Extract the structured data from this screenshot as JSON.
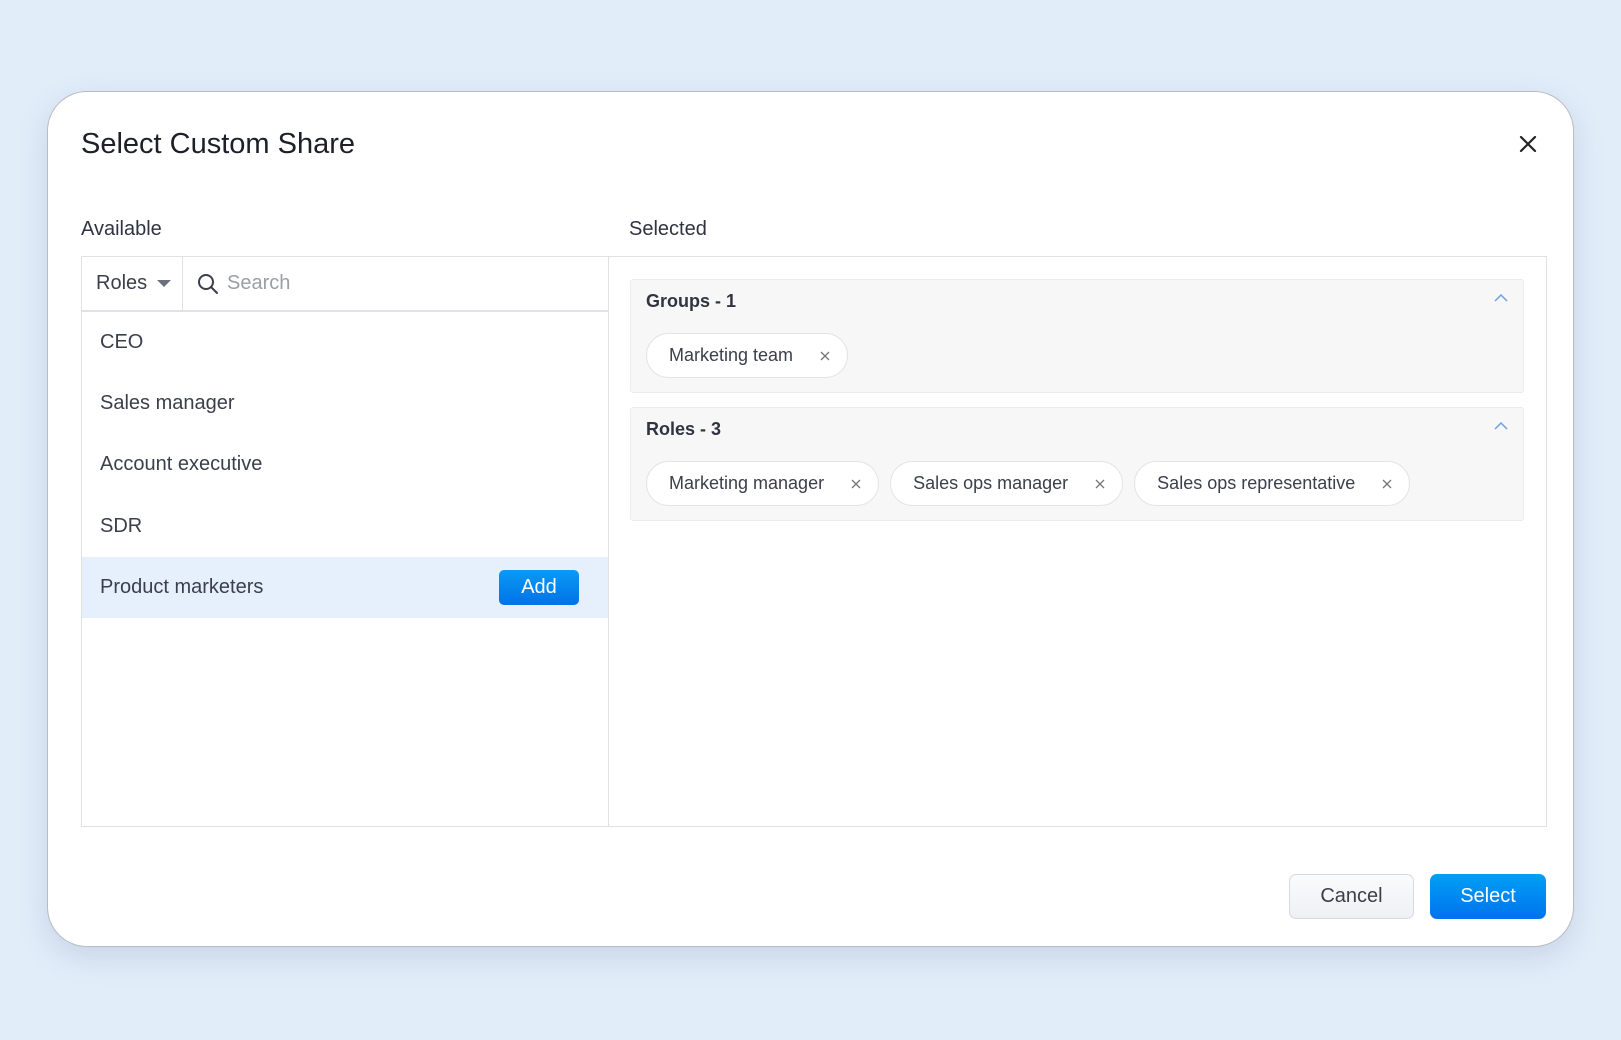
{
  "dialog": {
    "title": "Select Custom Share",
    "close_icon": "close-icon"
  },
  "available": {
    "label": "Available",
    "filter": "Roles",
    "search_placeholder": "Search",
    "items": [
      "CEO",
      "Sales manager",
      "Account executive",
      "SDR",
      "Product marketers"
    ],
    "add_label": "Add"
  },
  "selected": {
    "label": "Selected",
    "groups": [
      {
        "title": "Groups - 1",
        "chips": [
          "Marketing team"
        ]
      },
      {
        "title": "Roles - 3",
        "chips": [
          "Marketing manager",
          "Sales ops manager",
          "Sales ops representative"
        ]
      }
    ]
  },
  "footer": {
    "cancel": "Cancel",
    "select": "Select"
  },
  "colors": {
    "accent": "#0a84f0",
    "highlight": "#e5f0fc",
    "background": "#e2edfa"
  }
}
